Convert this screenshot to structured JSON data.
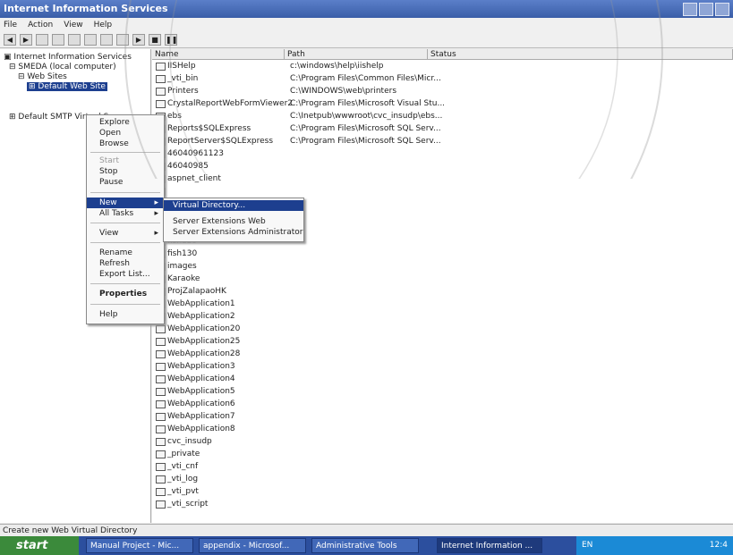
{
  "window": {
    "title": "Internet Information Services"
  },
  "menu": [
    "File",
    "Action",
    "View",
    "Help"
  ],
  "tree": {
    "root": "Internet Information Services",
    "computer": "SMEDA (local computer)",
    "web_sites": "Web Sites",
    "selected_site": "Default Web Site",
    "other_site": "Default SMTP Virtual Server"
  },
  "list": {
    "columns": [
      "Name",
      "Path",
      "Status"
    ],
    "rows": [
      {
        "name": "IISHelp",
        "path": "c:\\windows\\help\\iishelp"
      },
      {
        "name": "_vti_bin",
        "path": "C:\\Program Files\\Common Files\\Micr..."
      },
      {
        "name": "Printers",
        "path": "C:\\WINDOWS\\web\\printers"
      },
      {
        "name": "CrystalReportWebFormViewer2",
        "path": "C:\\Program Files\\Microsoft Visual Stu..."
      },
      {
        "name": "ebs",
        "path": "C:\\Inetpub\\wwwroot\\cvc_insudp\\ebs..."
      },
      {
        "name": "Reports$SQLExpress",
        "path": "C:\\Program Files\\Microsoft SQL Serv..."
      },
      {
        "name": "ReportServer$SQLExpress",
        "path": "C:\\Program Files\\Microsoft SQL Serv..."
      },
      {
        "name": "46040961123",
        "path": ""
      },
      {
        "name": "46040985",
        "path": ""
      },
      {
        "name": "aspnet_client",
        "path": ""
      },
      {
        "name": "",
        "path": ""
      },
      {
        "name": "",
        "path": ""
      },
      {
        "name": "",
        "path": ""
      },
      {
        "name": "fish",
        "path": ""
      },
      {
        "name": "fish123",
        "path": ""
      },
      {
        "name": "fish130",
        "path": ""
      },
      {
        "name": "images",
        "path": ""
      },
      {
        "name": "Karaoke",
        "path": ""
      },
      {
        "name": "ProjZalapaoHK",
        "path": ""
      },
      {
        "name": "WebApplication1",
        "path": ""
      },
      {
        "name": "WebApplication2",
        "path": ""
      },
      {
        "name": "WebApplication20",
        "path": ""
      },
      {
        "name": "WebApplication25",
        "path": ""
      },
      {
        "name": "WebApplication28",
        "path": ""
      },
      {
        "name": "WebApplication3",
        "path": ""
      },
      {
        "name": "WebApplication4",
        "path": ""
      },
      {
        "name": "WebApplication5",
        "path": ""
      },
      {
        "name": "WebApplication6",
        "path": ""
      },
      {
        "name": "WebApplication7",
        "path": ""
      },
      {
        "name": "WebApplication8",
        "path": ""
      },
      {
        "name": "cvc_insudp",
        "path": ""
      },
      {
        "name": "_private",
        "path": ""
      },
      {
        "name": "_vti_cnf",
        "path": ""
      },
      {
        "name": "_vti_log",
        "path": ""
      },
      {
        "name": "_vti_pvt",
        "path": ""
      },
      {
        "name": "_vti_script",
        "path": ""
      }
    ]
  },
  "context_menu": {
    "items": [
      "Explore",
      "Open",
      "Browse",
      "Start",
      "Stop",
      "Pause",
      "New",
      "All Tasks",
      "View",
      "Rename",
      "Refresh",
      "Export List...",
      "Properties",
      "Help"
    ]
  },
  "submenu": {
    "items": [
      "Virtual Directory...",
      "Server Extensions Web",
      "Server Extensions Administrator"
    ]
  },
  "status_bar": "Create new Web Virtual Directory",
  "taskbar": {
    "start": "start",
    "buttons": [
      "Manual Project - Mic...",
      "appendix - Microsof...",
      "Administrative Tools",
      "Internet Information ..."
    ],
    "tray_lang": "EN",
    "clock": "12:4"
  }
}
